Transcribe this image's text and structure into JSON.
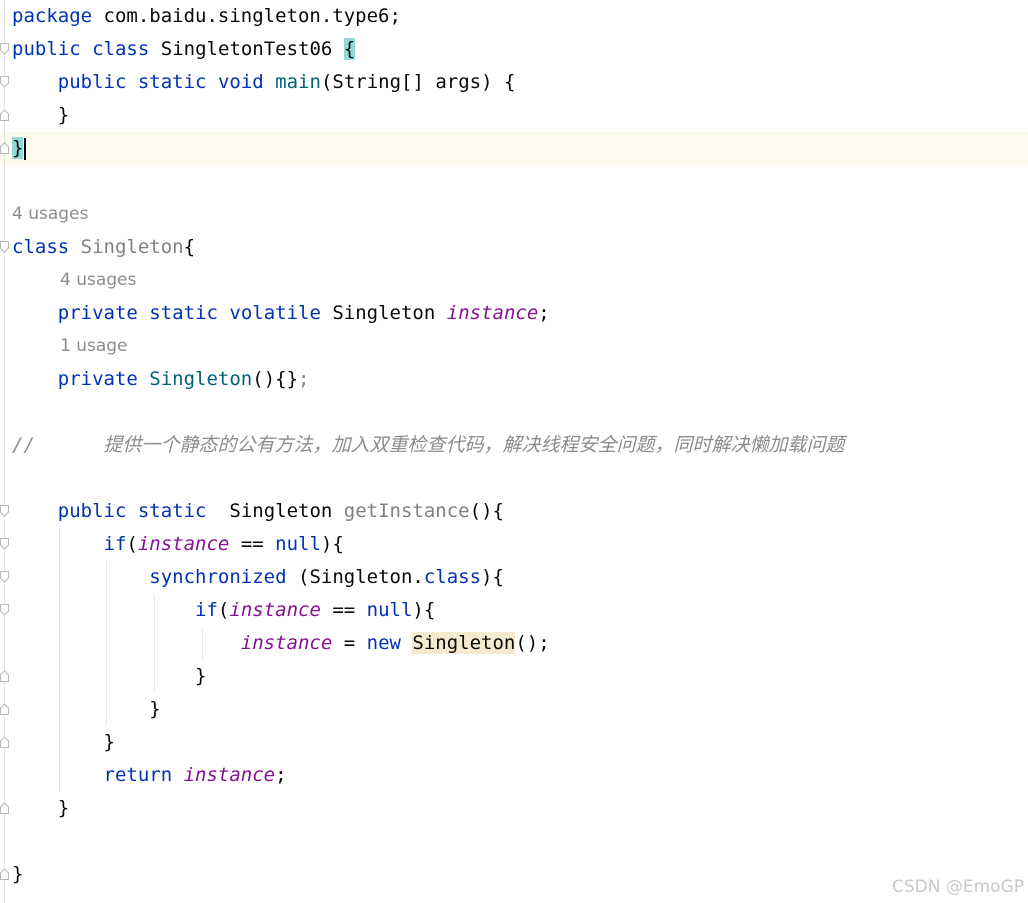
{
  "code": {
    "l1": {
      "kw": "package",
      "rest": " com.baidu.singleton.type6;"
    },
    "l2": {
      "kw1": "public",
      "kw2": "class",
      "name": "SingletonTest06",
      "brace": "{"
    },
    "l3": {
      "kw1": "public",
      "kw2": "static",
      "kw3": "void",
      "fn": "main",
      "rest": "(String[] args) {"
    },
    "l4": {
      "text": "}"
    },
    "l5": {
      "text": "}"
    },
    "hint1": "4 usages",
    "l6": {
      "kw": "class",
      "name": "Singleton",
      "rest": "{"
    },
    "hint2": "4 usages",
    "l7": {
      "kw1": "private",
      "kw2": "static",
      "kw3": "volatile",
      "type": "Singleton",
      "field": "instance",
      "semi": ";"
    },
    "hint3": "1 usage",
    "l8": {
      "kw": "private",
      "fn": "Singleton",
      "rest": "(){}",
      "semi": ";"
    },
    "comment": "//      提供一个静态的公有方法，加入双重检查代码，解决线程安全问题，同时解决懒加载问题",
    "l9": {
      "kw1": "public",
      "kw2": "static",
      "type": "Singleton",
      "fn": "getInstance",
      "rest": "(){"
    },
    "l10": {
      "kw": "if",
      "p1": "(",
      "field": "instance",
      "op": " == ",
      "null": "null",
      "p2": "){"
    },
    "l11": {
      "kw": "synchronized",
      "p1": " (Singleton.",
      "cls": "class",
      "p2": "){"
    },
    "l12": {
      "kw": "if",
      "p1": "(",
      "field": "instance",
      "op": " == ",
      "null": "null",
      "p2": "){"
    },
    "l13": {
      "field": "instance",
      "op": " = ",
      "kw": "new",
      "type": "Singleton",
      "rest": "();"
    },
    "l14": {
      "text": "}"
    },
    "l15": {
      "text": "}"
    },
    "l16": {
      "text": "}"
    },
    "l17": {
      "kw": "return",
      "field": "instance",
      "semi": ";"
    },
    "l18": {
      "text": "}"
    },
    "l19": {
      "text": "}"
    }
  },
  "watermark": "CSDN @EmoGP"
}
